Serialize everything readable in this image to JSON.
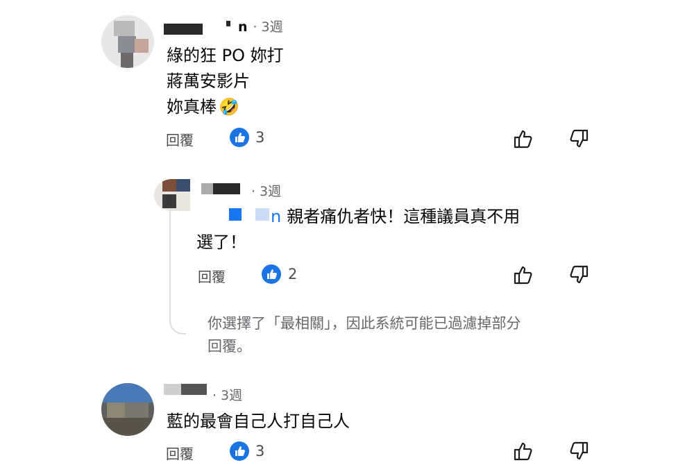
{
  "colors": {
    "like_blue": "#1b74e4",
    "meta_gray": "#65676b",
    "text": "#050505"
  },
  "comments": [
    {
      "meta_suffix": "n",
      "time": "3週",
      "lines": [
        "綠的狂 PO 妳打",
        "蔣萬安影片",
        "妳真棒"
      ],
      "emoji": "🤣",
      "reply_label": "回覆",
      "like_count": "3"
    },
    {
      "time": "3週",
      "mention_suffix": "n",
      "lines": [
        "親者痛仇者快！這種議員真不用",
        "選了！"
      ],
      "reply_label": "回覆",
      "like_count": "2"
    },
    {
      "time": "3週",
      "lines": [
        "藍的最會自己人打自己人"
      ],
      "reply_label": "回覆",
      "like_count": "3"
    }
  ],
  "filter_notice": [
    "你選擇了「最相關」，因此系統可能已過濾掉部分",
    "回覆。"
  ],
  "icons": {
    "like": "thumbs-up-icon",
    "dislike": "thumbs-down-icon",
    "badge": "like-badge-icon"
  }
}
